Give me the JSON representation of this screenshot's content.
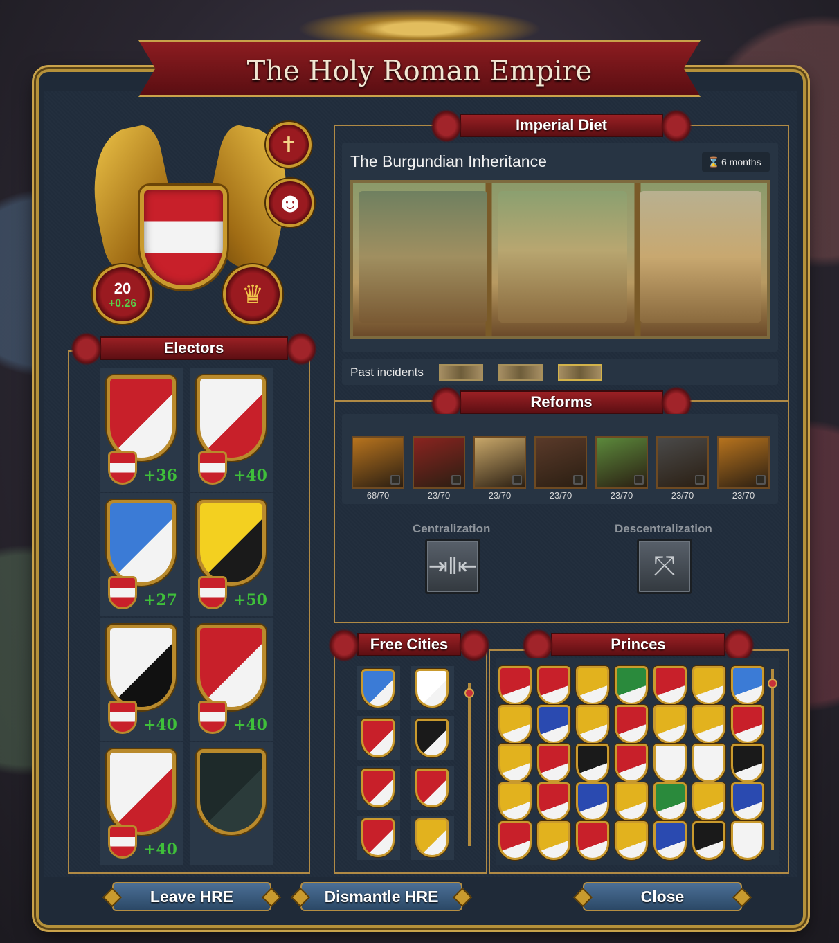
{
  "window": {
    "title": "The Holy Roman Empire"
  },
  "emperor": {
    "authority": "20",
    "authority_change": "+0.26",
    "religion_icon": "cross-icon",
    "opinion_icon": "smiley-icon",
    "crown_icon": "crown-icon"
  },
  "electors": {
    "header": "Electors",
    "items": [
      {
        "score": "+36",
        "colors": [
          "#c8202a",
          "#f3f3f3"
        ]
      },
      {
        "score": "+40",
        "colors": [
          "#f3f3f3",
          "#c8202a"
        ]
      },
      {
        "score": "+27",
        "colors": [
          "#3b7bd6",
          "#f3f3f3"
        ]
      },
      {
        "score": "+50",
        "colors": [
          "#f3d020",
          "#1a1a1a"
        ]
      },
      {
        "score": "+40",
        "colors": [
          "#f3f3f3",
          "#111111"
        ]
      },
      {
        "score": "+40",
        "colors": [
          "#c8202a",
          "#f3f3f3"
        ]
      },
      {
        "score": "+40",
        "colors": [
          "#f3f3f3",
          "#c8202a"
        ]
      },
      {
        "score": "",
        "colors": [
          "#1e2a2a",
          "#2b3b3a"
        ]
      }
    ]
  },
  "imperial_diet": {
    "header": "Imperial Diet",
    "incident_title": "The Burgundian Inheritance",
    "duration": "6 months",
    "past_incidents_label": "Past incidents"
  },
  "reforms": {
    "header": "Reforms",
    "items": [
      {
        "cost": "68/70",
        "color": "#b8741e"
      },
      {
        "cost": "23/70",
        "color": "#8a2420"
      },
      {
        "cost": "23/70",
        "color": "#c9a86a"
      },
      {
        "cost": "23/70",
        "color": "#5a3a2a"
      },
      {
        "cost": "23/70",
        "color": "#5c8a3c"
      },
      {
        "cost": "23/70",
        "color": "#4a4a4a"
      },
      {
        "cost": "23/70",
        "color": "#b8741e"
      }
    ],
    "centralization_label": "Centralization",
    "decentralization_label": "Descentralization"
  },
  "free_cities": {
    "header": "Free Cities",
    "shields": [
      "#3b7bd6",
      "#ffffff",
      "#c8202a",
      "#1a1a1a",
      "#c8202a",
      "#c8202a",
      "#c8202a",
      "#e2b21e"
    ]
  },
  "princes": {
    "header": "Princes",
    "shields": [
      "#c8202a",
      "#c8202a",
      "#e2b21e",
      "#2a8a3c",
      "#c8202a",
      "#e2b21e",
      "#3b7bd6",
      "#e2b21e",
      "#2a4ab0",
      "#e2b21e",
      "#c8202a",
      "#e2b21e",
      "#e2b21e",
      "#c8202a",
      "#e2b21e",
      "#c8202a",
      "#1a1a1a",
      "#c8202a",
      "#f3f3f3",
      "#f3f3f3",
      "#1a1a1a",
      "#e2b21e",
      "#c8202a",
      "#2a4ab0",
      "#e2b21e",
      "#2a8a3c",
      "#e2b21e",
      "#2a4ab0",
      "#c8202a",
      "#e2b21e",
      "#c8202a",
      "#e2b21e",
      "#2a4ab0",
      "#1a1a1a",
      "#f3f3f3"
    ]
  },
  "buttons": {
    "leave": "Leave HRE",
    "dismantle": "Dismantle HRE",
    "close": "Close"
  }
}
